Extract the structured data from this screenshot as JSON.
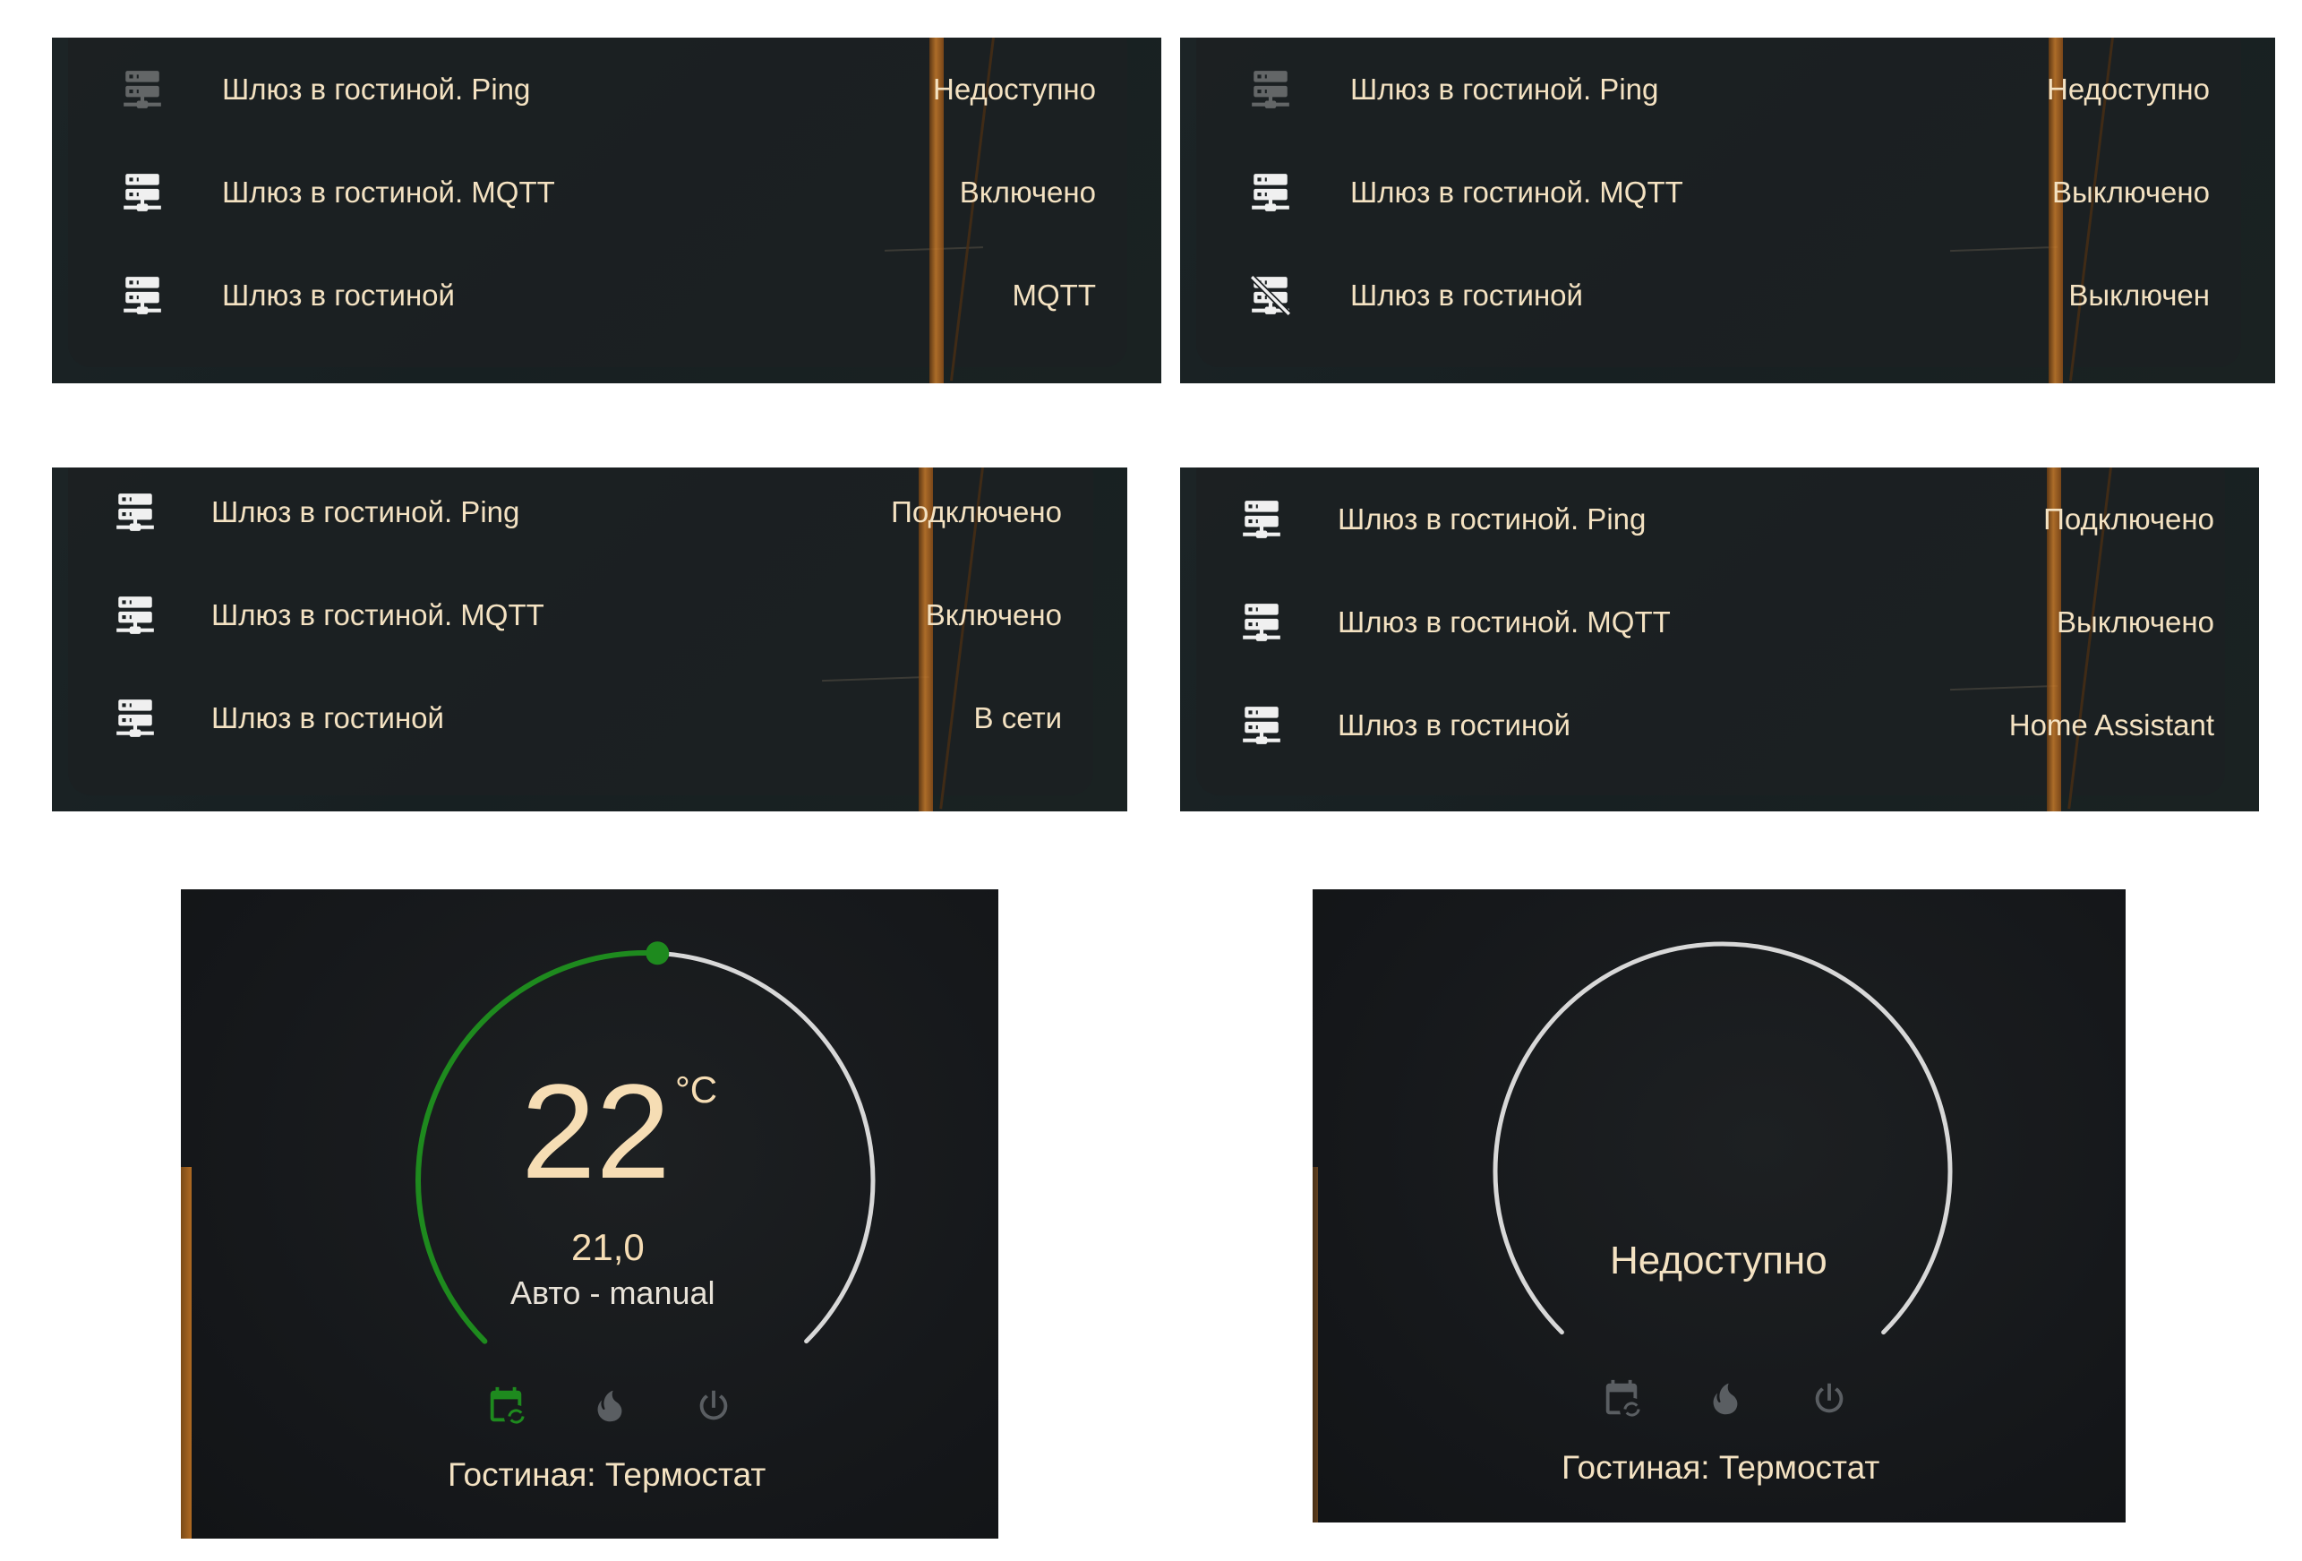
{
  "panels": [
    {
      "rows": [
        {
          "name": "Шлюз в гостиной. Ping",
          "state": "Недоступно",
          "icon": "server-network-icon",
          "dim": true
        },
        {
          "name": "Шлюз в гостиной. MQTT",
          "state": "Включено",
          "icon": "server-network-icon",
          "dim": false
        },
        {
          "name": "Шлюз в гостиной",
          "state": "MQTT",
          "icon": "server-network-icon",
          "dim": false
        }
      ]
    },
    {
      "rows": [
        {
          "name": "Шлюз в гостиной. Ping",
          "state": "Недоступно",
          "icon": "server-network-icon",
          "dim": true
        },
        {
          "name": "Шлюз в гостиной. MQTT",
          "state": "Выключено",
          "icon": "server-network-icon",
          "dim": false
        },
        {
          "name": "Шлюз в гостиной",
          "state": "Выключен",
          "icon": "server-network-off-icon",
          "dim": false
        }
      ]
    },
    {
      "rows": [
        {
          "name": "Шлюз в гостиной. Ping",
          "state": "Подключено",
          "icon": "server-network-icon",
          "dim": false
        },
        {
          "name": "Шлюз в гостиной. MQTT",
          "state": "Включено",
          "icon": "server-network-icon",
          "dim": false
        },
        {
          "name": "Шлюз в гостиной",
          "state": "В сети",
          "icon": "server-network-icon",
          "dim": false
        }
      ]
    },
    {
      "rows": [
        {
          "name": "Шлюз в гостиной. Ping",
          "state": "Подключено",
          "icon": "server-network-icon",
          "dim": false
        },
        {
          "name": "Шлюз в гостиной. MQTT",
          "state": "Выключено",
          "icon": "server-network-icon",
          "dim": false
        },
        {
          "name": "Шлюз в гостиной",
          "state": "Home Assistant",
          "icon": "server-network-icon",
          "dim": false
        }
      ]
    }
  ],
  "thermostats": [
    {
      "target": "22",
      "unit": "°C",
      "current": "21,0",
      "mode": "Авто - manual",
      "name": "Гостиная: Термостат",
      "active_mode": "auto",
      "target_fraction": 0.5,
      "arc_color": "#1e8a1e",
      "modes": [
        "calendar-sync-icon",
        "fire-icon",
        "power-icon"
      ]
    },
    {
      "status": "Недоступно",
      "name": "Гостиная: Термостат",
      "modes": [
        "calendar-sync-icon",
        "fire-icon",
        "power-icon"
      ]
    }
  ],
  "colors": {
    "text": "#f4e2c2",
    "arc_track": "#d8d8d8",
    "arc_active": "#1e8a1e",
    "mast": "#c67a2a"
  }
}
